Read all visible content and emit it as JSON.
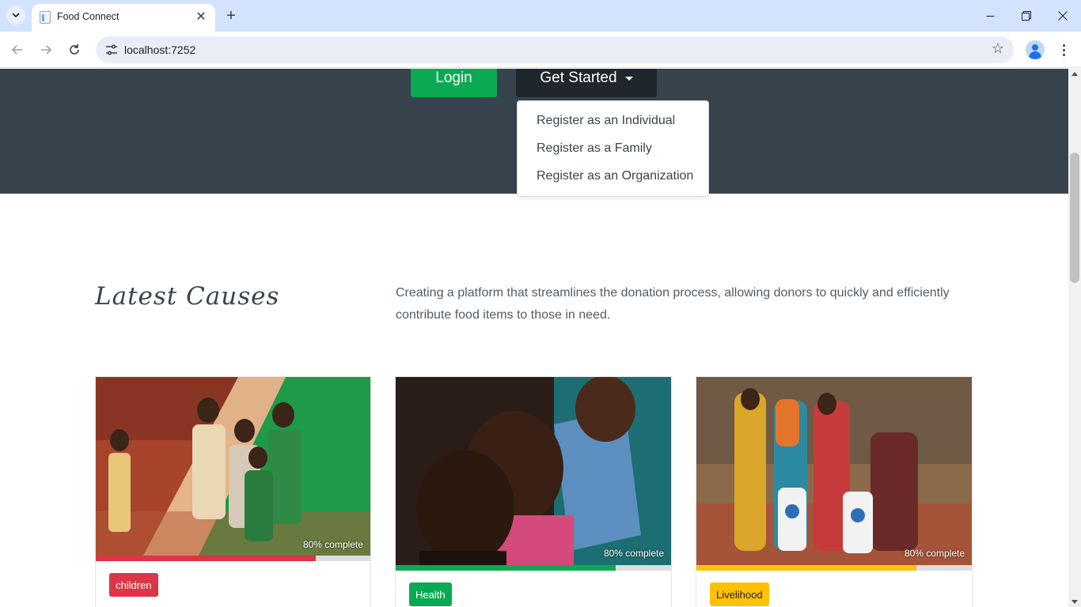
{
  "browser": {
    "tab_title": "Food Connect",
    "url": "localhost:7252"
  },
  "hero": {
    "login_label": "Login",
    "get_started_label": "Get Started",
    "dropdown_items": [
      "Register as an Individual",
      "Register as a Family",
      "Register as an Organization"
    ]
  },
  "section": {
    "title": "Latest Causes",
    "description": "Creating a platform that streamlines the donation process, allowing donors to quickly and efficiently contribute food items to those in need."
  },
  "causes": [
    {
      "tag": "children",
      "progress_label": "80% complete",
      "progress": 0.8,
      "tag_color": "#dc3545",
      "tag_text_color": "#ffffff",
      "bar_color": "#dc3545"
    },
    {
      "tag": "Health",
      "progress_label": "80% complete",
      "progress": 0.8,
      "tag_color": "#0aaa52",
      "tag_text_color": "#ffffff",
      "bar_color": "#0aaa52"
    },
    {
      "tag": "Livelihood",
      "progress_label": "80% complete",
      "progress": 0.8,
      "tag_color": "#ffc107",
      "tag_text_color": "#212529",
      "bar_color": "#ffc107"
    }
  ],
  "colors": {
    "hero_bg": "#37444e",
    "login_bg": "#0aaa52",
    "get_started_bg": "#1f272d"
  },
  "icons": [
    "tab-search-icon",
    "page-icon",
    "close-icon",
    "plus-icon",
    "minimize-icon",
    "restore-icon",
    "window-close-icon",
    "back-arrow-icon",
    "forward-arrow-icon",
    "reload-icon",
    "site-settings-icon",
    "star-icon",
    "profile-icon",
    "more-vert-icon",
    "caret-down-icon"
  ]
}
